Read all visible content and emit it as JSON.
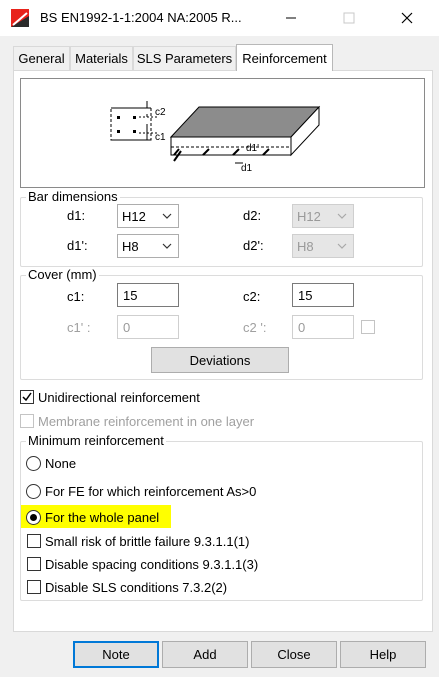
{
  "window": {
    "title": "BS EN1992-1-1:2004 NA:2005 R...",
    "icon": "app-icon",
    "minimize_glyph": "—",
    "close_glyph": "✕"
  },
  "tabs": [
    {
      "label": "General",
      "active": false
    },
    {
      "label": "Materials",
      "active": false
    },
    {
      "label": "SLS Parameters",
      "active": false
    },
    {
      "label": "Reinforcement",
      "active": true
    }
  ],
  "diagram": {
    "labels": {
      "c2": "c2",
      "c1": "c1",
      "d1_prime": "d1'",
      "d1": "d1"
    }
  },
  "bar_dimensions": {
    "title": "Bar dimensions",
    "d1": {
      "label": "d1:",
      "value": "H12",
      "enabled": true
    },
    "d1_prime": {
      "label": "d1':",
      "value": "H8",
      "enabled": true
    },
    "d2": {
      "label": "d2:",
      "value": "H12",
      "enabled": false
    },
    "d2_prime": {
      "label": "d2':",
      "value": "H8",
      "enabled": false
    }
  },
  "cover": {
    "title": "Cover (mm)",
    "c1": {
      "label": "c1:",
      "value": "15",
      "enabled": true
    },
    "c2": {
      "label": "c2:",
      "value": "15",
      "enabled": true
    },
    "c1_prime": {
      "label": "c1' :",
      "value": "0",
      "enabled": false
    },
    "c2_prime": {
      "label": "c2 ':",
      "value": "0",
      "enabled": false
    },
    "deviations_button": "Deviations"
  },
  "options": {
    "unidirectional": {
      "label": "Unidirectional reinforcement",
      "checked": true
    },
    "membrane": {
      "label": "Membrane reinforcement in one layer",
      "checked": false,
      "enabled": false
    }
  },
  "minimum_reinforcement": {
    "title": "Minimum reinforcement",
    "radios": [
      {
        "label": "None",
        "selected": false
      },
      {
        "label": "For FE for which reinforcement As>0",
        "selected": false
      },
      {
        "label": "For the whole panel",
        "selected": true
      }
    ],
    "checks": [
      {
        "label": "Small risk of brittle failure  9.3.1.1(1)",
        "checked": false
      },
      {
        "label": "Disable spacing conditions 9.3.1.1(3)",
        "checked": false
      },
      {
        "label": "Disable SLS conditions 7.3.2(2)",
        "checked": false
      }
    ]
  },
  "footer": {
    "note": "Note",
    "add": "Add",
    "close": "Close",
    "help": "Help"
  },
  "colors": {
    "accent": "#0078d7",
    "highlight": "#ffff00",
    "icon_red": "#e8231b"
  }
}
